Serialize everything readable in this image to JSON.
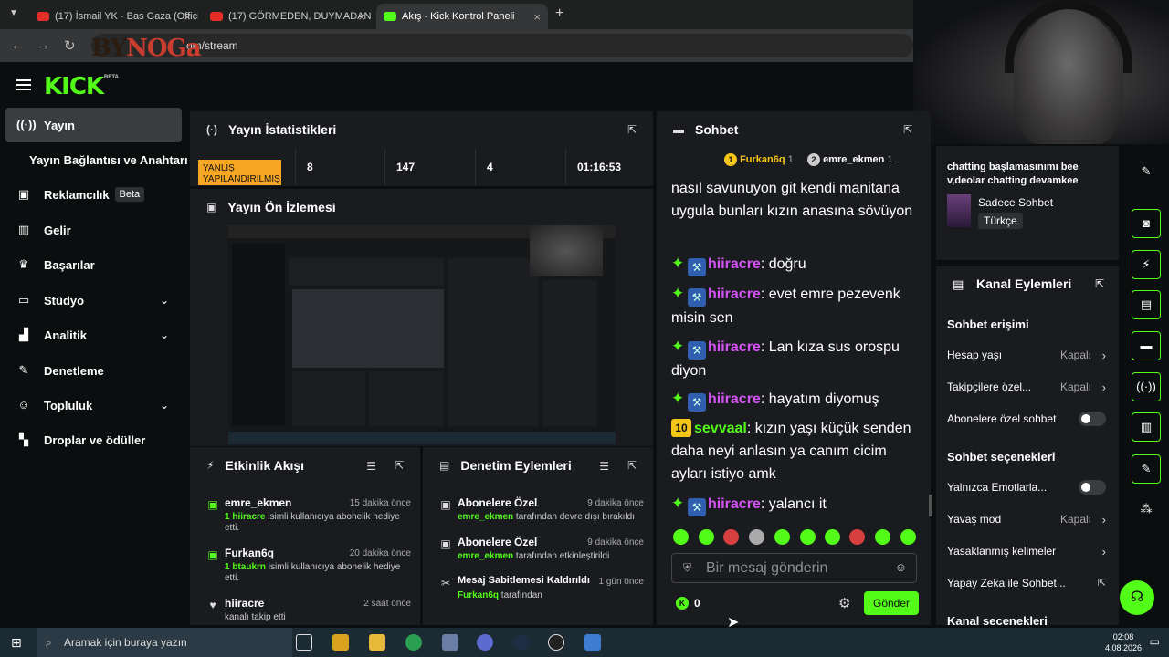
{
  "browser": {
    "tabs": [
      {
        "title": "(17) İsmail YK - Bas Gaza (Offici"
      },
      {
        "title": "(17) GÖRMEDEN, DUYMADAN"
      },
      {
        "title": "Akış - Kick Kontrol Paneli"
      }
    ],
    "url": "om/stream",
    "overlay_text_a": "BY",
    "overlay_text_b": "NOGa"
  },
  "kick": {
    "logo": "KICK",
    "beta": "BETA"
  },
  "sidebar": {
    "items": [
      {
        "label": "Yayın",
        "icon": "broadcast-icon"
      },
      {
        "label": "Yayın Bağlantısı ve Anahtarı",
        "icon": ""
      },
      {
        "label": "Reklamcılık",
        "icon": "ad-icon",
        "tag": "Beta"
      },
      {
        "label": "Gelir",
        "icon": "revenue-icon"
      },
      {
        "label": "Başarılar",
        "icon": "trophy-icon"
      },
      {
        "label": "Stüdyo",
        "icon": "studio-icon"
      },
      {
        "label": "Analitik",
        "icon": "analytics-icon"
      },
      {
        "label": "Denetleme",
        "icon": "wrench-icon"
      },
      {
        "label": "Topluluk",
        "icon": "community-icon"
      },
      {
        "label": "Droplar ve ödüller",
        "icon": "drops-icon"
      }
    ]
  },
  "stats": {
    "title": "Yayın İstatistikleri",
    "warning": "YANLIŞ YAPILANDIRILMIŞ",
    "values": [
      "8",
      "147",
      "4",
      "01:16:53"
    ]
  },
  "preview": {
    "title": "Yayın Ön İzlemesi"
  },
  "activity": {
    "title": "Etkinlik Akışı",
    "items": [
      {
        "name": "emre_ekmen",
        "time": "15 dakika önce",
        "highlight": "1 hiiracre",
        "desc": " isimli kullanıcıya abonelik hediye etti."
      },
      {
        "name": "Furkan6q",
        "time": "20 dakika önce",
        "highlight": "1 btaukrn",
        "desc": " isimli kullanıcıya abonelik hediye etti."
      },
      {
        "name": "hiiracre",
        "time": "2 saat önce",
        "highlight": "",
        "desc": "kanalı takip etti"
      }
    ]
  },
  "moderation": {
    "title": "Denetim Eylemleri",
    "items": [
      {
        "name": "Abonelere Özel",
        "time": "9 dakika önce",
        "highlight": "emre_ekmen",
        "desc": " tarafından devre dışı bırakıldı"
      },
      {
        "name": "Abonelere Özel",
        "time": "9 dakika önce",
        "highlight": "emre_ekmen",
        "desc": " tarafından etkinleştirildi"
      },
      {
        "name": "Mesaj Sabitlemesi Kaldırıldı",
        "time": "1 gün önce",
        "highlight": "Furkan6q",
        "desc": " tarafından"
      }
    ]
  },
  "chat": {
    "title": "Sohbet",
    "top_users": [
      {
        "rank": "1",
        "name": "Furkan6q",
        "count": "1"
      },
      {
        "rank": "2",
        "name": "emre_ekmen",
        "count": "1"
      }
    ],
    "first_message": "nasıl savunuyon git kendi manitana uygula bunları kızın anasına sövüyon",
    "messages": [
      {
        "user": "hiiracre",
        "text": "doğru"
      },
      {
        "user": "hiiracre",
        "text": "evet emre pezevenk misin sen"
      },
      {
        "user": "hiiracre",
        "text": "Lan kıza sus orospu diyon"
      },
      {
        "user": "hiiracre",
        "text": "hayatım diyomuş"
      },
      {
        "user": "sevvaal",
        "badge": "10",
        "text": "kızın yaşı küçük senden daha neyi anlasın ya canım cicim ayları istiyo amk"
      },
      {
        "user": "hiiracre",
        "text": "yalancı it"
      }
    ],
    "input_placeholder": "Bir mesaj gönderin",
    "kick_count": "0",
    "send_label": "Gönder"
  },
  "stream_info": {
    "title": "chatting başlamasınımı bee v,deolar chatting devamkee",
    "category": "Sadece Sohbet",
    "language": "Türkçe"
  },
  "channel_actions": {
    "title": "Kanal Eylemleri",
    "chat_access": "Sohbet erişimi",
    "account_age": {
      "label": "Hesap yaşı",
      "value": "Kapalı"
    },
    "followers_only": {
      "label": "Takipçilere özel...",
      "value": "Kapalı"
    },
    "subs_only": {
      "label": "Abonelere özel sohbet"
    },
    "chat_options": "Sohbet seçenekleri",
    "emote_only": {
      "label": "Yalnızca Emotlarla..."
    },
    "slow_mode": {
      "label": "Yavaş mod",
      "value": "Kapalı"
    },
    "banned_words": {
      "label": "Yasaklanmış kelimeler"
    },
    "ai_chat": {
      "label": "Yapay Zeka ile Sohbet..."
    },
    "channel_options": "Kanal seçenekleri"
  },
  "taskbar": {
    "search_placeholder": "Aramak için buraya yazın",
    "time": "02:08",
    "date": "4.08.2026"
  },
  "colors": {
    "accent": "#53fc18",
    "panel": "#191b1f",
    "bg": "#0b0e0f",
    "username": "#d553f5"
  }
}
